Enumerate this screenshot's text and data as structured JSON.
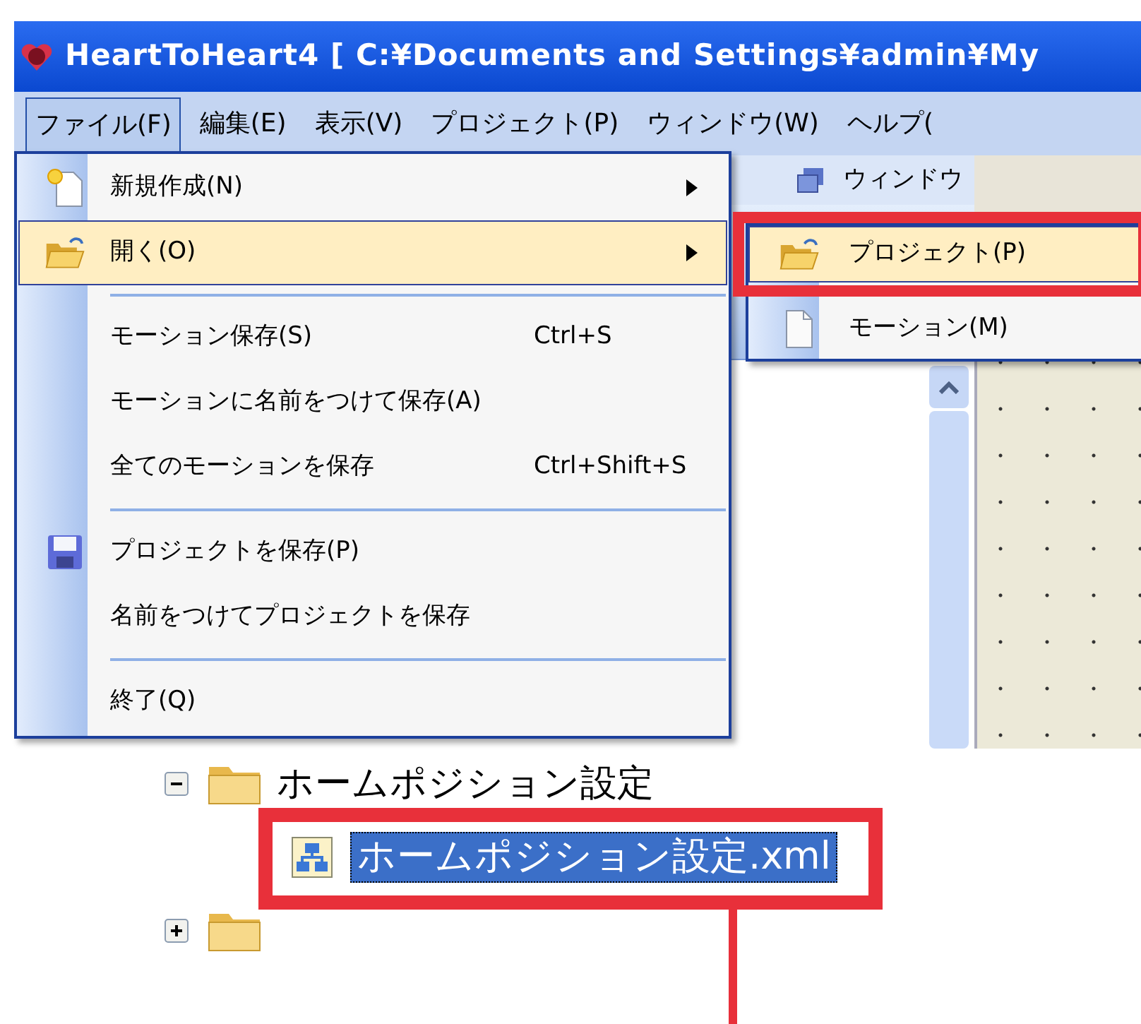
{
  "window": {
    "title": "HeartToHeart4 [ C:¥Documents and Settings¥admin¥My"
  },
  "menu_bar": [
    {
      "label": "ファイル(F)",
      "selected": true
    },
    {
      "label": "編集(E)",
      "selected": false
    },
    {
      "label": "表示(V)",
      "selected": false
    },
    {
      "label": "プロジェクト(P)",
      "selected": false
    },
    {
      "label": "ウィンドウ(W)",
      "selected": false
    },
    {
      "label": "ヘルプ(",
      "selected": false
    }
  ],
  "toolbar": {
    "label": "ウィンドウ"
  },
  "file_menu": [
    {
      "kind": "item",
      "label": "新規作成(N)",
      "submenu": true,
      "selected": false
    },
    {
      "kind": "item",
      "label": "開く(O)",
      "submenu": true,
      "selected": true
    },
    {
      "kind": "separator"
    },
    {
      "kind": "item",
      "label": "モーション保存(S)",
      "shortcut": "Ctrl+S",
      "submenu": false,
      "selected": false
    },
    {
      "kind": "item",
      "label": "モーションに名前をつけて保存(A)",
      "submenu": false,
      "selected": false
    },
    {
      "kind": "item",
      "label": "全てのモーションを保存",
      "shortcut": "Ctrl+Shift+S",
      "submenu": false,
      "selected": false
    },
    {
      "kind": "separator"
    },
    {
      "kind": "item",
      "label": "プロジェクトを保存(P)",
      "submenu": false,
      "selected": false
    },
    {
      "kind": "item",
      "label": "名前をつけてプロジェクトを保存",
      "submenu": false,
      "selected": false
    },
    {
      "kind": "separator"
    },
    {
      "kind": "item",
      "label": "終了(Q)",
      "submenu": false,
      "selected": false
    }
  ],
  "open_submenu": [
    {
      "label": "プロジェクト(P)",
      "selected": true
    },
    {
      "label": "モーション(M)",
      "selected": false
    }
  ],
  "tree": [
    {
      "label": "ホームポジション設定",
      "expanded": true,
      "children": [
        {
          "label": "ホームポジション設定.xml",
          "selected": true
        }
      ]
    },
    {
      "expanded": false
    }
  ]
}
